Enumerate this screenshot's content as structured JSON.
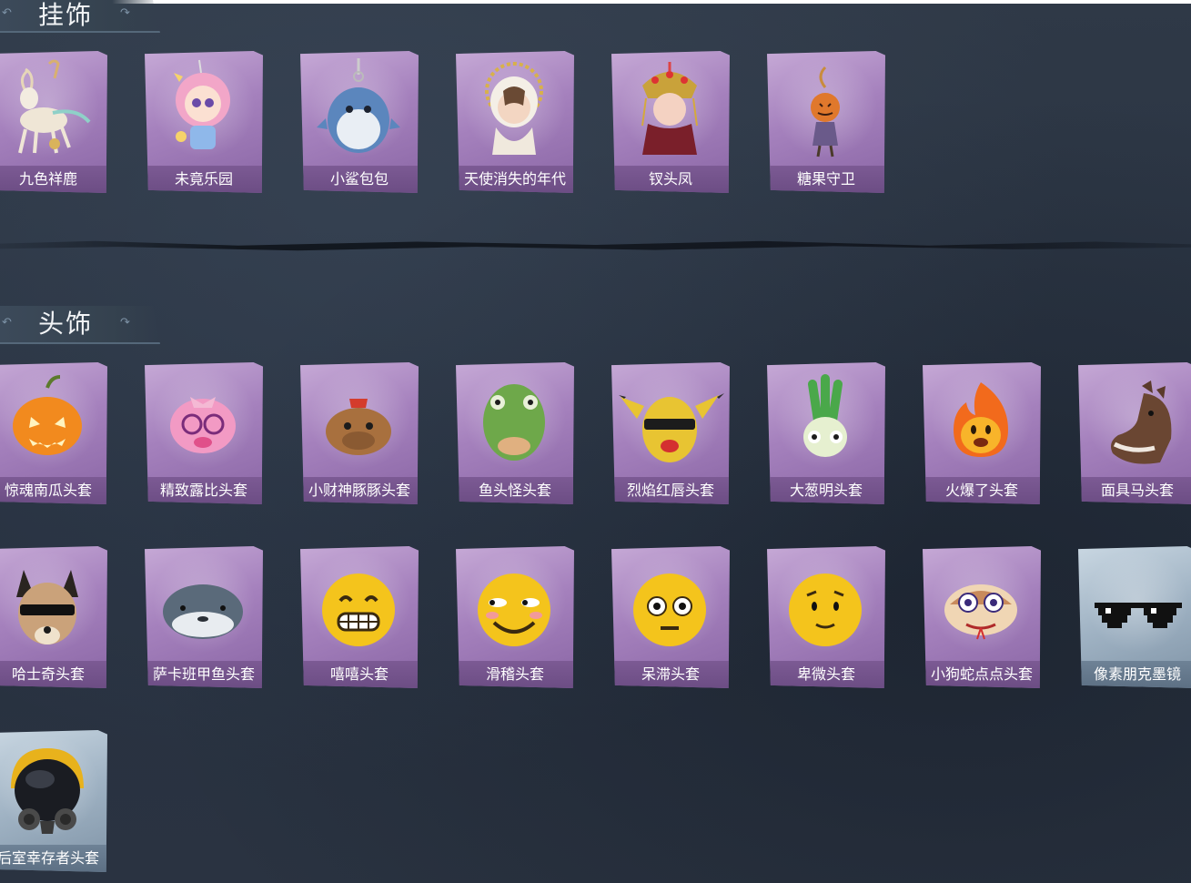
{
  "sections": {
    "pendants": {
      "title": "挂饰",
      "items": [
        {
          "label": "九色祥鹿",
          "icon": "deer-pendant-icon"
        },
        {
          "label": "未竟乐园",
          "icon": "doll-pendant-icon"
        },
        {
          "label": "小鲨包包",
          "icon": "shark-bag-icon"
        },
        {
          "label": "天使消失的年代",
          "icon": "angel-doll-icon"
        },
        {
          "label": "钗头凤",
          "icon": "phoenix-crown-doll-icon"
        },
        {
          "label": "糖果守卫",
          "icon": "pumpkin-guard-icon"
        }
      ]
    },
    "headwear": {
      "title": "头饰",
      "items": [
        {
          "label": "惊魂南瓜头套",
          "icon": "pumpkin-head-icon"
        },
        {
          "label": "精致露比头套",
          "icon": "pink-beaver-head-icon"
        },
        {
          "label": "小财神豚豚头套",
          "icon": "capybara-head-icon"
        },
        {
          "label": "鱼头怪头套",
          "icon": "fish-head-icon"
        },
        {
          "label": "烈焰红唇头套",
          "icon": "yellow-mask-head-icon"
        },
        {
          "label": "大葱明头套",
          "icon": "green-onion-head-icon"
        },
        {
          "label": "火爆了头套",
          "icon": "fire-head-icon"
        },
        {
          "label": "面具马头套",
          "icon": "horse-head-icon"
        },
        {
          "label": "哈士奇头套",
          "icon": "husky-head-icon"
        },
        {
          "label": "萨卡班甲鱼头套",
          "icon": "sacabambaspis-head-icon"
        },
        {
          "label": "嘻嘻头套",
          "icon": "grin-emoji-head-icon"
        },
        {
          "label": "滑稽头套",
          "icon": "funny-emoji-head-icon"
        },
        {
          "label": "呆滞头套",
          "icon": "dazed-emoji-head-icon"
        },
        {
          "label": "卑微头套",
          "icon": "humble-emoji-head-icon"
        },
        {
          "label": "小狗蛇点点头套",
          "icon": "snake-head-icon"
        },
        {
          "label": "像素朋克墨镜",
          "icon": "pixel-sunglasses-icon"
        },
        {
          "label": "后室幸存者头套",
          "icon": "gas-mask-helmet-icon"
        }
      ]
    }
  },
  "colors": {
    "background": "#2b3442",
    "card_purple": "#a581bd",
    "card_blue": "#9fb2c3",
    "label_text": "#ffffff"
  }
}
